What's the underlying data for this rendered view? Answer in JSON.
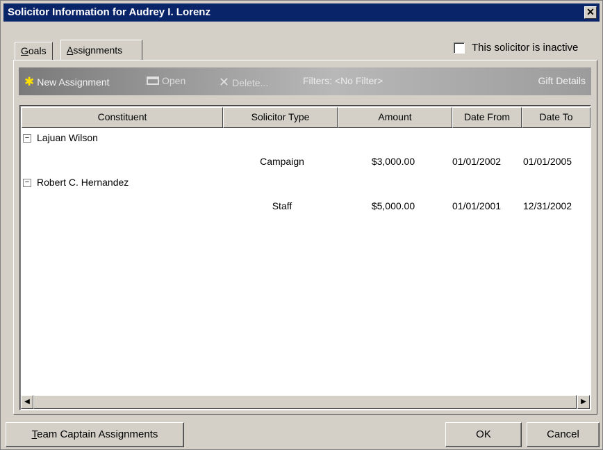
{
  "window": {
    "title": "Solicitor Information for Audrey I. Lorenz",
    "close_glyph": "✕"
  },
  "tabs": [
    {
      "accel": "G",
      "rest": "oals"
    },
    {
      "accel": "A",
      "rest": "ssignments"
    }
  ],
  "inactive_label": "This solicitor is inactive",
  "toolbar": {
    "new_label": "New Assignment",
    "open_label": "Open",
    "delete_label": "Delete...",
    "filters_label": "Filters: <No Filter>",
    "gift_details_label": "Gift Details",
    "icons": {
      "new": "new-document-icon",
      "open": "folder-icon",
      "delete": "delete-x-icon"
    }
  },
  "grid": {
    "columns": [
      "Constituent",
      "Solicitor Type",
      "Amount",
      "Date From",
      "Date To"
    ],
    "groups": [
      {
        "constituent": "Lajuan Wilson",
        "toggle": "−",
        "assignment": {
          "type": "Campaign",
          "amount": "$3,000.00",
          "date_from": "01/01/2002",
          "date_to": "01/01/2005"
        }
      },
      {
        "constituent": "Robert C. Hernandez",
        "toggle": "−",
        "assignment": {
          "type": "Staff",
          "amount": "$5,000.00",
          "date_from": "01/01/2001",
          "date_to": "12/31/2002"
        }
      }
    ]
  },
  "scrollbar": {
    "left_glyph": "◀",
    "right_glyph": "▶"
  },
  "buttons": {
    "team_accel": "T",
    "team_rest": "eam Captain Assignments",
    "ok_label": "OK",
    "cancel_label": "Cancel"
  },
  "colors": {
    "titlebar": "#0a246a",
    "face": "#d4d0c8",
    "toolbar_dark": "#7a7a7a"
  }
}
